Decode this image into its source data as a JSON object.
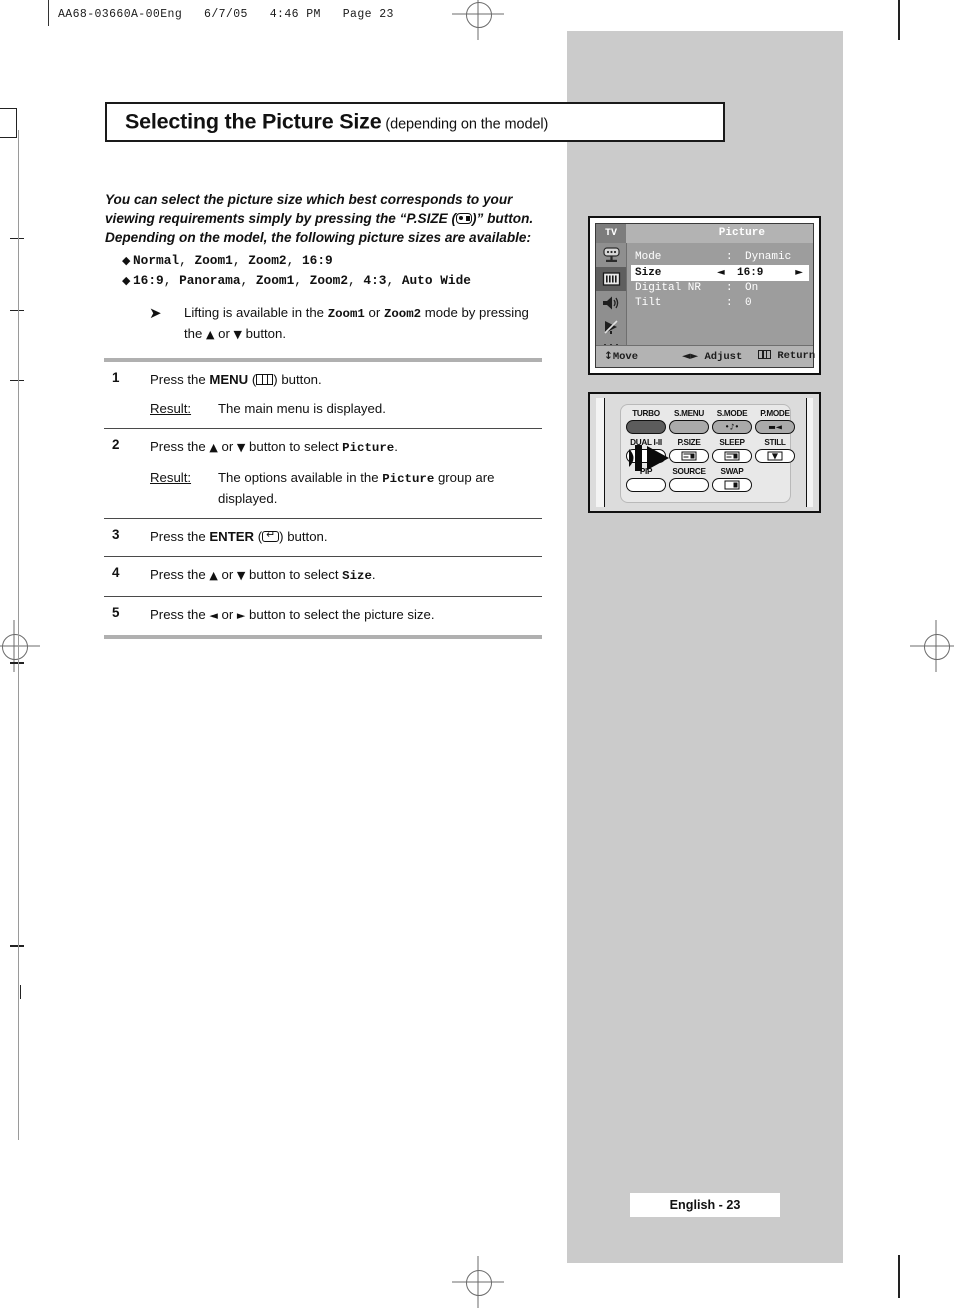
{
  "print_header": "AA68-03660A-00Eng   6/7/05   4:46 PM   Page 23",
  "title": {
    "main": "Selecting the Picture Size",
    "sub": " (depending on the model)"
  },
  "intro": {
    "line1": "You can select the picture size which best corresponds to your",
    "line2_a": "viewing requirements simply by pressing the “P.SIZE (",
    "line2_b": ")” button.",
    "line3": "Depending on the model, the following picture sizes are available:",
    "psize_icon": "picture-size-icon"
  },
  "bullets": [
    {
      "diamond": "◆",
      "items": [
        "Normal",
        "Zoom1",
        "Zoom2",
        "16:9"
      ]
    },
    {
      "diamond": "◆",
      "items": [
        "16:9",
        "Panorama",
        "Zoom1",
        "Zoom2",
        "4:3",
        "Auto Wide"
      ]
    }
  ],
  "note": {
    "arrow": "➤",
    "text_a": "Lifting is available in the ",
    "mode1": "Zoom1",
    "text_b": " or ",
    "mode2": "Zoom2",
    "text_c": " mode by pressing the ",
    "up": "▲",
    "text_d": " or ",
    "down": "▼",
    "text_e": " button."
  },
  "steps": [
    {
      "num": "1",
      "text_a": "Press the ",
      "key": "MENU",
      "text_b": " (",
      "icon": "menu-icon",
      "text_c": ") button.",
      "result_label": "Result:",
      "result_value": "The main menu is displayed."
    },
    {
      "num": "2",
      "text_a": "Press the ",
      "up": "▲",
      "text_b": " or ",
      "down": "▼",
      "text_c": " button to select ",
      "mono": "Picture",
      "text_d": ".",
      "result_label": "Result:",
      "result_value_a": "The options available in the ",
      "result_mono": "Picture",
      "result_value_b": " group are displayed."
    },
    {
      "num": "3",
      "text_a": "Press the ",
      "key": "ENTER",
      "text_b": " (",
      "icon": "enter-icon",
      "text_c": ") button."
    },
    {
      "num": "4",
      "text_a": "Press the ",
      "up": "▲",
      "text_b": " or ",
      "down": "▼",
      "text_c": " button to select ",
      "mono": "Size",
      "text_d": "."
    },
    {
      "num": "5",
      "text_a": "Press the ",
      "left": "◄",
      "text_b": " or ",
      "right": "►",
      "text_c": " button to select the picture size."
    }
  ],
  "osd": {
    "source_label": "TV",
    "title": "Picture",
    "sidebar_icons": [
      "input-source-icon",
      "picture-icon",
      "sound-icon",
      "channel-dish-icon",
      "setup-sliders-icon"
    ],
    "selected_sidebar_index": 1,
    "rows": [
      {
        "label": "Mode",
        "colon": ":",
        "value": "Dynamic",
        "highlight": false
      },
      {
        "label": "Size",
        "colon": ":",
        "value": "16:9",
        "highlight": true,
        "left_arrow": "◄",
        "right_arrow": "►"
      },
      {
        "label": "Digital NR",
        "colon": ":",
        "value": "On",
        "highlight": false
      },
      {
        "label": "Tilt",
        "colon": ":",
        "value": "0",
        "highlight": false
      }
    ],
    "bottom_bar": {
      "move_glyph": "↕",
      "move": "Move",
      "adjust_glyph": "◄►",
      "adjust": "Adjust",
      "return_icon": "menu-icon",
      "return": "Return"
    }
  },
  "remote": {
    "rows": [
      [
        {
          "label": "TURBO",
          "style": "fill-dark",
          "glyph": ""
        },
        {
          "label": "S.MENU",
          "style": "fill-mid",
          "glyph": ""
        },
        {
          "label": "S.MODE",
          "style": "fill-mid",
          "glyph": "•♪•"
        },
        {
          "label": "P.MODE",
          "style": "fill-mid",
          "glyph": "▬◄"
        }
      ],
      [
        {
          "label": "DUAL I-II",
          "style": "plain",
          "glyph": ""
        },
        {
          "label": "P.SIZE",
          "style": "plain",
          "glyph": "icon-lines"
        },
        {
          "label": "SLEEP",
          "style": "plain",
          "glyph": "icon-lines"
        },
        {
          "label": "STILL",
          "style": "plain",
          "glyph": "▼"
        }
      ],
      [
        {
          "label": "PIP",
          "style": "plain",
          "glyph": ""
        },
        {
          "label": "SOURCE",
          "style": "plain",
          "glyph": ""
        },
        {
          "label": "SWAP",
          "style": "plain",
          "glyph": "icon-swap"
        }
      ]
    ],
    "pointer": "pointer-arrow"
  },
  "footer": "English - 23",
  "colors": {
    "gray_panel": "#cbcbcb",
    "osd_body": "#9d9d9d",
    "osd_bar": "#b3b3b3",
    "rule": "#b0b0b0",
    "ink": "#111111"
  }
}
